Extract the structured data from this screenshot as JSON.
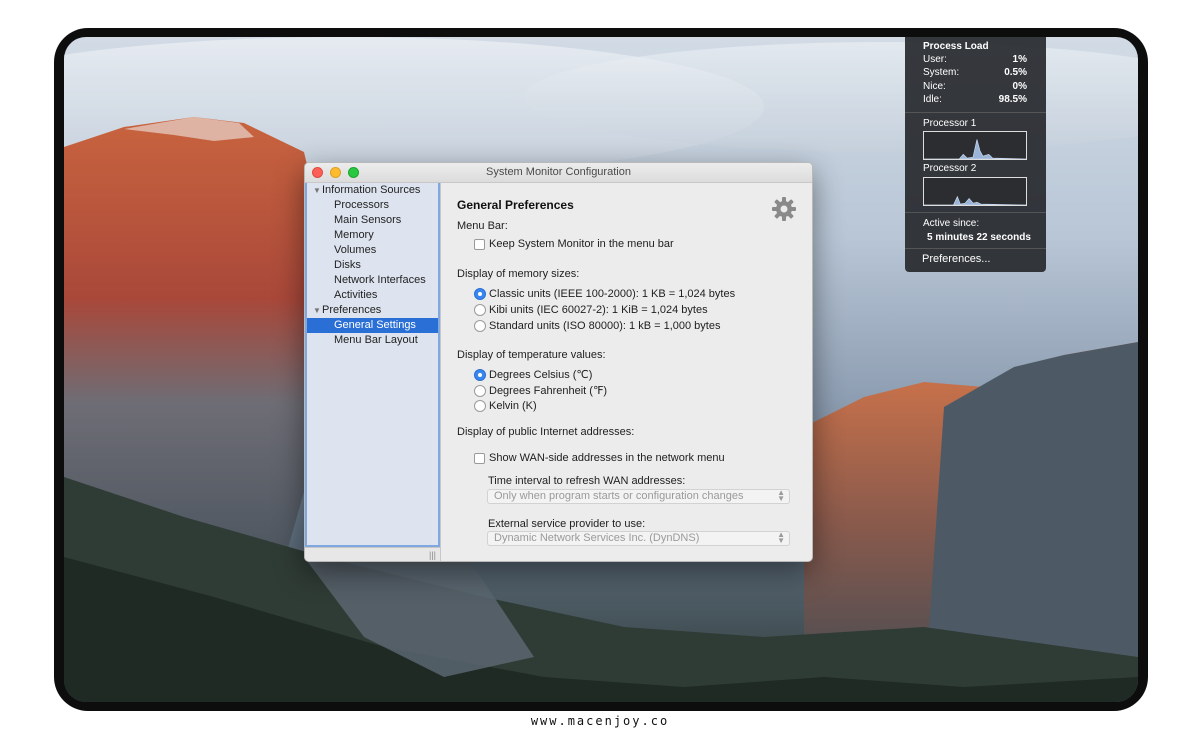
{
  "window": {
    "title": "System Monitor Configuration"
  },
  "sidebar": {
    "groups": [
      {
        "label": "Information Sources",
        "items": [
          "Processors",
          "Main Sensors",
          "Memory",
          "Volumes",
          "Disks",
          "Network Interfaces",
          "Activities"
        ]
      },
      {
        "label": "Preferences",
        "items": [
          "General Settings",
          "Menu Bar Layout"
        ]
      }
    ],
    "selected_item": "General Settings"
  },
  "content": {
    "title": "General Preferences",
    "menu_bar": {
      "label": "Menu Bar:",
      "keep_in_menu_bar": {
        "label": "Keep System Monitor in the menu bar",
        "checked": false
      }
    },
    "memory_sizes": {
      "label": "Display of memory sizes:",
      "options": [
        {
          "label": "Classic units (IEEE 100-2000): 1 KB = 1,024 bytes",
          "selected": true
        },
        {
          "label": "Kibi units (IEC 60027-2): 1 KiB = 1,024 bytes",
          "selected": false
        },
        {
          "label": "Standard units (ISO 80000): 1 kB = 1,000 bytes",
          "selected": false
        }
      ]
    },
    "temperature": {
      "label": "Display of temperature values:",
      "options": [
        {
          "label": "Degrees Celsius (℃)",
          "selected": true
        },
        {
          "label": "Degrees Fahrenheit (℉)",
          "selected": false
        },
        {
          "label": "Kelvin (K)",
          "selected": false
        }
      ]
    },
    "public_addresses": {
      "label": "Display of public Internet addresses:",
      "show_wan": {
        "label": "Show WAN-side addresses in the network menu",
        "checked": false
      },
      "refresh_label": "Time interval to refresh WAN addresses:",
      "refresh_value": "Only when program starts or configuration changes",
      "provider_label": "External service provider to use:",
      "provider_value": "Dynamic Network Services Inc. (DynDNS)"
    }
  },
  "process_load": {
    "title": "Process Load",
    "stats": [
      {
        "label": "User:",
        "value": "1%"
      },
      {
        "label": "System:",
        "value": "0.5%"
      },
      {
        "label": "Nice:",
        "value": "0%"
      },
      {
        "label": "Idle:",
        "value": "98.5%"
      }
    ],
    "processor1_label": "Processor 1",
    "processor2_label": "Processor 2",
    "active_since_label": "Active since:",
    "active_since_value": "5 minutes 22 seconds",
    "preferences_label": "Preferences..."
  },
  "footer": {
    "url": "www.macenjoy.co"
  },
  "colors": {
    "selection": "#2a6fd6",
    "close": "#fc5f57",
    "minimize": "#fdbc2e",
    "zoom": "#28c840"
  }
}
